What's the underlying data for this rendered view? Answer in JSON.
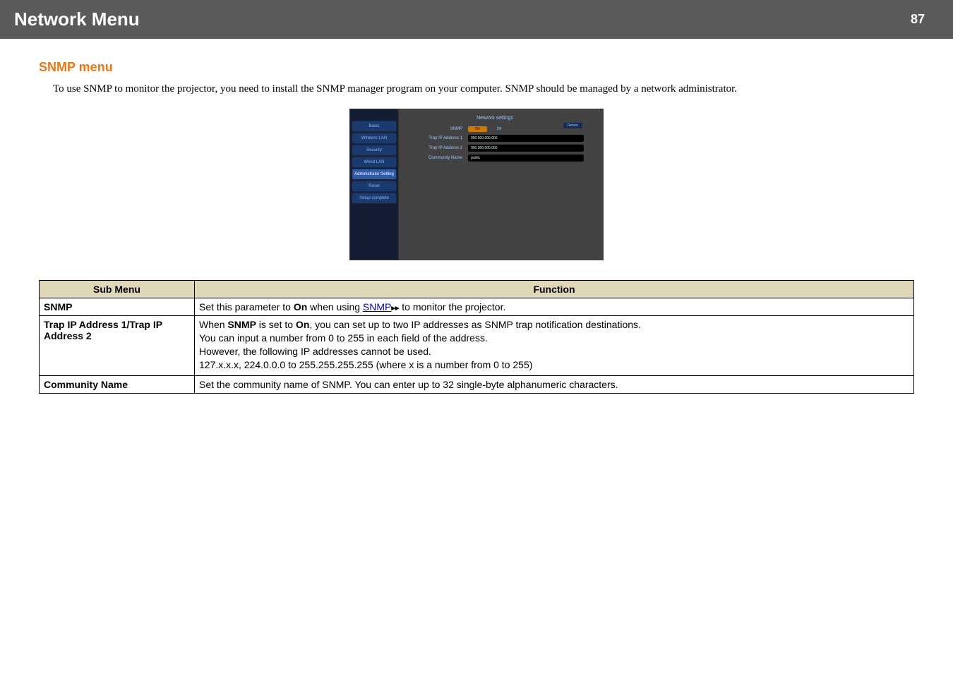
{
  "header": {
    "title": "Network Menu",
    "page": "87"
  },
  "section": {
    "heading": "SNMP menu"
  },
  "intro": "To use SNMP to monitor the projector, you need to install the SNMP manager program on your computer. SNMP should be managed by a network administrator.",
  "screenshot": {
    "title": "Network settings",
    "return_label": "Return",
    "sidebar": [
      "Basic",
      "Wireless LAN",
      "Security",
      "Wired LAN",
      "Administrator Setting",
      "Reset",
      "Setup complete"
    ],
    "rows": {
      "snmp_label": "SNMP",
      "on": "On",
      "off": "Off",
      "trap1_label": "Trap IP Address 1",
      "trap1_value": "000.000.000.000",
      "trap2_label": "Trap IP Address 2",
      "trap2_value": "000.000.000.000",
      "community_label": "Community Name",
      "community_value": "public"
    }
  },
  "table": {
    "headers": {
      "submenu": "Sub Menu",
      "function": "Function"
    },
    "rows": [
      {
        "submenu": "SNMP",
        "parts": {
          "a": "Set this parameter to ",
          "on": "On",
          "b": " when using ",
          "link": "SNMP",
          "c": " to monitor the projector."
        }
      },
      {
        "submenu": "Trap IP Address 1/Trap IP Address 2",
        "parts": {
          "l1a": "When ",
          "l1b": "SNMP",
          "l1c": " is set to ",
          "l1d": "On",
          "l1e": ", you can set up to two IP addresses as SNMP trap notification destinations.",
          "l2": "You can input a number from 0 to 255 in each field of the address.",
          "l3": "However, the following IP addresses cannot be used.",
          "l4": "127.x.x.x, 224.0.0.0 to 255.255.255.255 (where x is a number from 0 to 255)"
        }
      },
      {
        "submenu": "Community Name",
        "parts": {
          "l1": "Set the community name of SNMP. You can enter up to 32 single-byte alphanumeric characters."
        }
      }
    ]
  }
}
